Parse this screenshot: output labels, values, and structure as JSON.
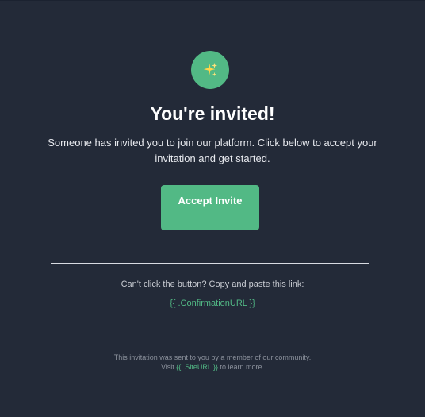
{
  "header": {
    "icon_name": "sparkles-icon",
    "icon_bg": "#52b985"
  },
  "title": "You're invited!",
  "description": "Someone has invited you to join our platform. Click below to accept your invitation and get started.",
  "button": {
    "label": "Accept Invite",
    "color": "#52b985"
  },
  "fallback": {
    "text": "Can't click the button? Copy and paste this link:",
    "link": "{{ .ConfirmationURL }}"
  },
  "footer": {
    "line1": "This invitation was sent to you by a member of our community.",
    "visit_prefix": "Visit",
    "site_link": "{{ .SiteURL }}",
    "visit_suffix": "to learn more."
  },
  "colors": {
    "background": "#232a38",
    "accent": "#52b985"
  }
}
